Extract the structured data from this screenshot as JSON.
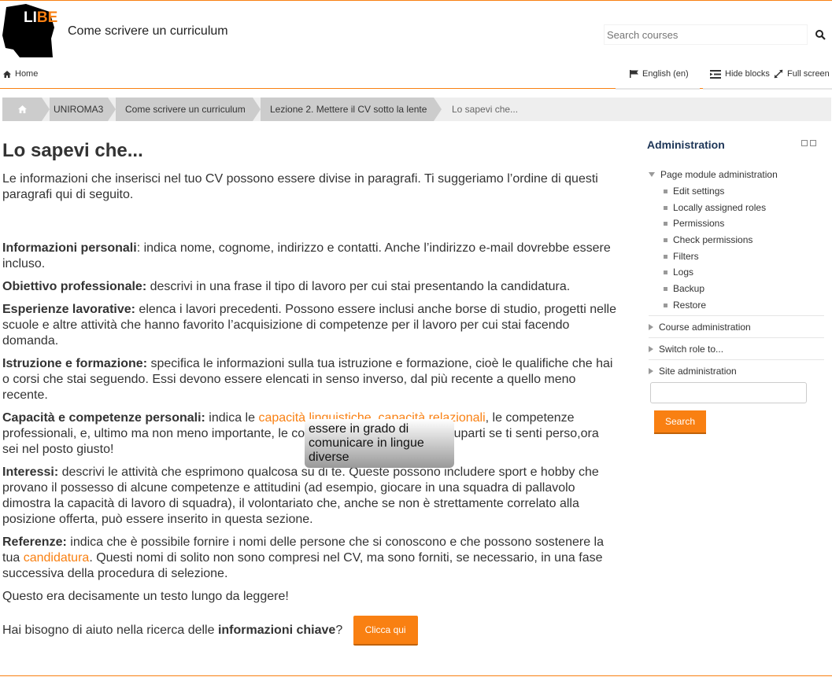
{
  "header": {
    "logo_text_a": "LI",
    "logo_text_b": "BE",
    "site_title": "Come scrivere un curriculum",
    "search_placeholder": "Search courses"
  },
  "nav": {
    "home": "Home",
    "language": "English (en)",
    "hide_blocks": "Hide blocks",
    "full_screen": "Full screen"
  },
  "breadcrumb": [
    "UNIROMA3",
    "Come scrivere un curriculum",
    "Lezione 2. Mettere il CV sotto la lente",
    "Lo sapevi che..."
  ],
  "page": {
    "title": "Lo sapevi che...",
    "intro": "Le informazioni che inserisci nel tuo CV possono essere divise in paragrafi. Ti suggeriamo l’ordine di questi paragrafi qui di seguito.",
    "sections": [
      {
        "head": "Informazioni personali",
        "text": ": indica nome, cognome, indirizzo e contatti. Anche l’indirizzo e-mail dovrebbe essere incluso."
      },
      {
        "head": "Obiettivo professionale:",
        "text": " descrivi in una frase il tipo di lavoro per cui stai presentando la candidatura."
      },
      {
        "head": "Esperienze lavorative:",
        "text": " elenca i lavori precedenti. Possono essere inclusi anche borse di studio, progetti nelle scuole e altre attività che hanno favorito l’acquisizione di competenze per il lavoro per cui stai facendo domanda."
      },
      {
        "head": "Istruzione e formazione:",
        "text": " specifica le informazioni sulla tua istruzione e formazione, cioè le qualifiche che hai o corsi che stai seguendo. Essi devono essere elencati in senso inverso, dal più recente a quello meno recente."
      }
    ],
    "capacita_head": "Capacità e competenze personali:",
    "capacita_a": " indica le ",
    "capacita_hidden": "capacità linguistiche",
    "capacita_b": ", ",
    "capacita_link": "capacità relazionali",
    "capacita_c": ", le competenze professionali, e, ultimo ma non meno importante, le competenze ICT. Non preoccuparti se ti senti perso,ora sei nel posto giusto!",
    "tooltip": "essere in grado di comunicare in lingue diverse",
    "interessi_head": "Interessi:",
    "interessi_text": " descrivi le attività che esprimono qualcosa su di te. Queste possono includere sport e hobby che provano il possesso di alcune competenze e attitudini (ad esempio, giocare in una squadra di pallavolo dimostra la capacità di lavoro di squadra), il volontariato che, anche se non è strettamente correlato alla posizione offerta, può essere inserito in questa sezione.",
    "referenze_head": "Referenze:",
    "referenze_a": " indica che è possibile fornire i nomi delle persone che si conoscono e che possono sostenere la tua ",
    "referenze_link": "candidatura",
    "referenze_b": ". Questi nomi di solito non sono compresi nel CV, ma sono forniti, se necessario, in una fase successiva della procedura di selezione.",
    "long_text": "Questo era decisamente un testo lungo da leggere!",
    "help_a": "Hai bisogno di aiuto nella ricerca delle ",
    "help_b": "informazioni chiave",
    "help_c": "?",
    "cta": "Clicca qui"
  },
  "admin": {
    "title": "Administration",
    "page_module": "Page module administration",
    "items": [
      "Edit settings",
      "Locally assigned roles",
      "Permissions",
      "Check permissions",
      "Filters",
      "Logs",
      "Backup",
      "Restore"
    ],
    "course_admin": "Course administration",
    "switch_role": "Switch role to...",
    "site_admin": "Site administration",
    "search_label": "Search"
  },
  "colors": {
    "accent": "#f98012"
  }
}
